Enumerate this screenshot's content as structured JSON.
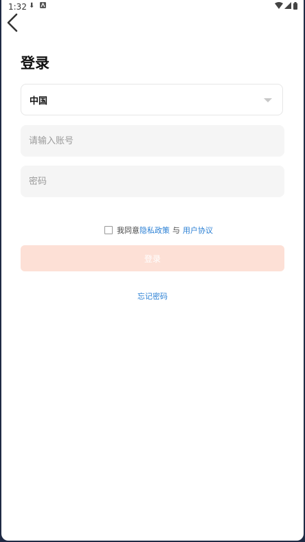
{
  "status_bar": {
    "time": "1:32",
    "left_icons": [
      "download-icon",
      "app-a-icon"
    ],
    "right_icons": [
      "wifi-icon",
      "signal-icon",
      "battery-icon"
    ]
  },
  "header": {
    "back_icon": "chevron-left-icon"
  },
  "login": {
    "title": "登录",
    "country_value": "中国",
    "account_placeholder": "请输入账号",
    "password_placeholder": "密码",
    "agreement": {
      "prefix": "我同意",
      "privacy_link": "隐私政策",
      "separator": "与",
      "terms_link": "用户协议",
      "checked": false
    },
    "submit_label": "登录",
    "forgot_password": "忘记密码"
  },
  "colors": {
    "link": "#2a7fd4",
    "submit_disabled_bg": "#fde0d6",
    "input_bg": "#f5f5f5"
  }
}
